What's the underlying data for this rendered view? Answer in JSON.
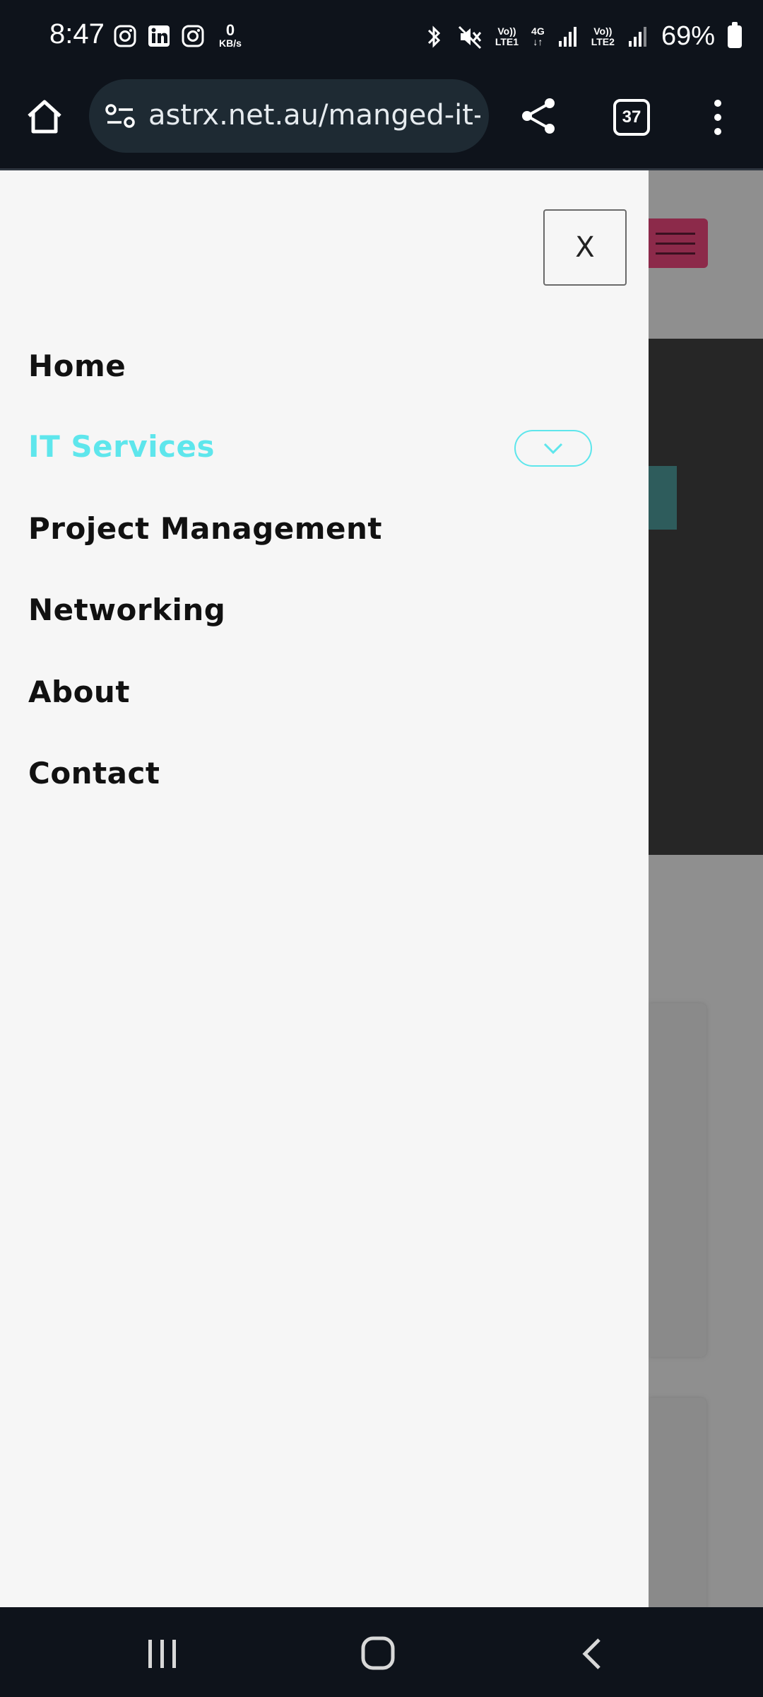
{
  "status_bar": {
    "time": "8:47",
    "data_speed_value": "0",
    "data_speed_unit": "KB/s",
    "sim1_label_top": "Vo))",
    "sim1_label_bottom": "LTE1",
    "network_type": "4G",
    "sim2_label_top": "Vo))",
    "sim2_label_bottom": "LTE2",
    "battery": "69%",
    "notification_icons": [
      "instagram-icon",
      "linkedin-icon",
      "instagram-icon"
    ]
  },
  "browser": {
    "url": "astrx.net.au/manged-it-s",
    "tab_count": "37"
  },
  "drawer": {
    "close_label": "X",
    "menu": [
      {
        "label": "Home",
        "active": false
      },
      {
        "label": "IT Services",
        "active": true,
        "has_dropdown": true
      },
      {
        "label": "Project Management",
        "active": false
      },
      {
        "label": "Networking",
        "active": false
      },
      {
        "label": "About",
        "active": false
      },
      {
        "label": "Contact",
        "active": false
      }
    ]
  },
  "colors": {
    "active_menu": "#5ee6ec",
    "drawer_background": "#f6f6f6",
    "overlay": "#8f8f8f",
    "hamburger": "#8c2a4a",
    "system_bars": "#0e131b"
  }
}
